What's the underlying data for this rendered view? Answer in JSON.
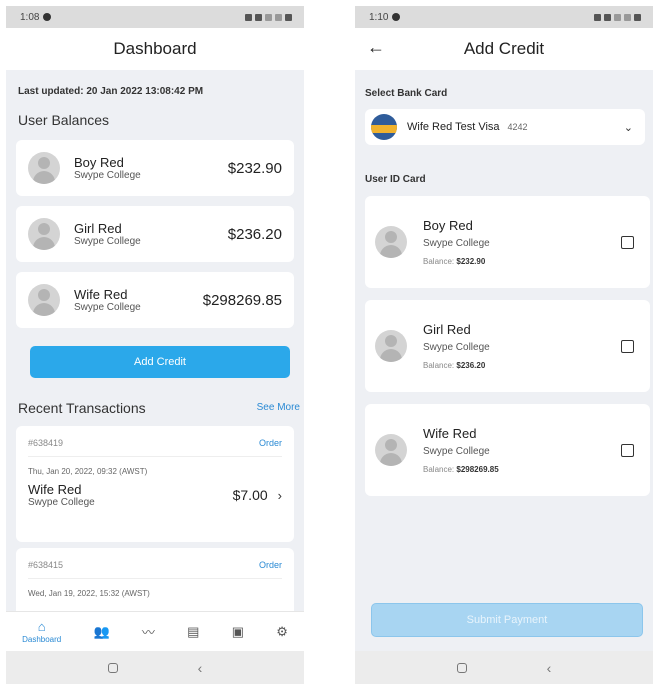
{
  "colors": {
    "accent": "#2ba8ea",
    "link": "#2a8ad4",
    "background": "#eef0f4",
    "disabled_button": "#a8d5f2"
  },
  "dashboard": {
    "status_time": "1:08",
    "title": "Dashboard",
    "last_updated": "Last updated: 20 Jan 2022 13:08:42 PM",
    "balances_title": "User Balances",
    "users": [
      {
        "name": "Boy Red",
        "org": "Swype College",
        "amount": "$232.90"
      },
      {
        "name": "Girl Red",
        "org": "Swype College",
        "amount": "$236.20"
      },
      {
        "name": "Wife Red",
        "org": "Swype College",
        "amount": "$298269.85"
      }
    ],
    "add_credit_label": "Add Credit",
    "recent_title": "Recent Transactions",
    "see_more_label": "See More",
    "transactions": [
      {
        "id": "#638419",
        "type": "Order",
        "date": "Thu, Jan 20, 2022, 09:32 (AWST)",
        "name": "Wife Red",
        "org": "Swype College",
        "amount": "$7.00"
      },
      {
        "id": "#638415",
        "type": "Order",
        "date": "Wed, Jan 19, 2022, 15:32 (AWST)"
      }
    ],
    "nav": [
      {
        "label": "Dashboard",
        "icon": "home-icon",
        "active": true
      },
      {
        "label": "",
        "icon": "users-icon"
      },
      {
        "label": "",
        "icon": "trend-icon"
      },
      {
        "label": "",
        "icon": "store-icon"
      },
      {
        "label": "",
        "icon": "bus-icon"
      },
      {
        "label": "",
        "icon": "settings-icon"
      }
    ]
  },
  "add_credit": {
    "status_time": "1:10",
    "title": "Add Credit",
    "select_bank_label": "Select Bank Card",
    "bank_card": {
      "name": "Wife Red Test Visa",
      "last4": "4242"
    },
    "user_id_label": "User ID Card",
    "users": [
      {
        "name": "Boy Red",
        "org": "Swype College",
        "balance_label": "Balance:",
        "balance": "$232.90"
      },
      {
        "name": "Girl Red",
        "org": "Swype College",
        "balance_label": "Balance:",
        "balance": "$236.20"
      },
      {
        "name": "Wife Red",
        "org": "Swype College",
        "balance_label": "Balance:",
        "balance": "$298269.85"
      }
    ],
    "submit_label": "Submit Payment"
  }
}
